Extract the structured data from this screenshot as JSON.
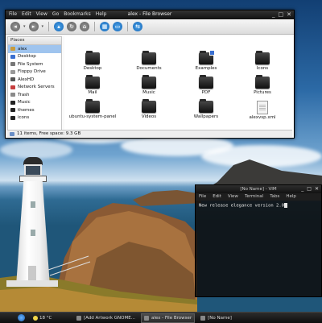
{
  "file_browser": {
    "title": "alex - File Browser",
    "menu": [
      "File",
      "Edit",
      "View",
      "Go",
      "Bookmarks",
      "Help"
    ],
    "window_buttons": [
      "_",
      "□",
      "✕"
    ],
    "toolbar": [
      {
        "icon": "back-arrow-icon",
        "glyph": "◂"
      },
      {
        "icon": "forward-arrow-icon",
        "glyph": "▸"
      },
      {
        "icon": "up-arrow-icon",
        "glyph": "▴"
      },
      {
        "icon": "reload-icon",
        "glyph": "↻"
      },
      {
        "icon": "home-icon",
        "glyph": "⌂"
      },
      {
        "icon": "folder-view-icon",
        "glyph": "▦"
      },
      {
        "icon": "computer-icon",
        "glyph": "▭"
      },
      {
        "icon": "network-icon",
        "glyph": "⇆"
      }
    ],
    "sidebar": {
      "header": "Places",
      "items": [
        {
          "label": "alex",
          "color": "#c89b3c",
          "active": true
        },
        {
          "label": "Desktop",
          "color": "#3a6fd0",
          "active": false
        },
        {
          "label": "File System",
          "color": "#777777",
          "active": false
        },
        {
          "label": "Floppy Drive",
          "color": "#999999",
          "active": false
        },
        {
          "label": "AlexHD",
          "color": "#555555",
          "active": false
        },
        {
          "label": "Network Servers",
          "color": "#c63d3d",
          "active": false
        },
        {
          "label": "Trash",
          "color": "#8a8a8a",
          "active": false
        },
        {
          "label": "Music",
          "color": "#222222",
          "active": false
        },
        {
          "label": "themes",
          "color": "#222222",
          "active": false
        },
        {
          "label": "icons",
          "color": "#222222",
          "active": false
        }
      ]
    },
    "items": [
      {
        "label": "Desktop",
        "type": "folder",
        "icon": "desktop-folder-icon"
      },
      {
        "label": "Documents",
        "type": "folder",
        "icon": "documents-folder-icon"
      },
      {
        "label": "Examples",
        "type": "folder-link",
        "icon": "examples-folder-icon"
      },
      {
        "label": "Icons",
        "type": "folder",
        "icon": "icons-folder-icon"
      },
      {
        "label": "Mail",
        "type": "folder",
        "icon": "mail-folder-icon"
      },
      {
        "label": "Music",
        "type": "folder",
        "icon": "music-folder-icon"
      },
      {
        "label": "PDF",
        "type": "folder",
        "icon": "pdf-folder-icon"
      },
      {
        "label": "Pictures",
        "type": "folder",
        "icon": "pictures-folder-icon"
      },
      {
        "label": "ubuntu-system-panel",
        "type": "folder",
        "icon": "ubuntu-system-panel-folder-icon"
      },
      {
        "label": "Videos",
        "type": "folder",
        "icon": "videos-folder-icon"
      },
      {
        "label": "Wallpapers",
        "type": "folder",
        "icon": "wallpapers-folder-icon"
      },
      {
        "label": "alexvsp.xml",
        "type": "file",
        "icon": "xml-file-icon"
      }
    ],
    "status": "11 items, Free space: 9.3 GB"
  },
  "terminal": {
    "title": "[No Name] - VIM",
    "menu": [
      "File",
      "Edit",
      "View",
      "Terminal",
      "Tabs",
      "Help"
    ],
    "window_buttons": [
      "_",
      "□",
      "✕"
    ],
    "line": "New release elegance version 2.0"
  },
  "taskbar": {
    "weather": "18 °C",
    "tasks": [
      {
        "label": "[Add Artwork GNOME...",
        "active": false
      },
      {
        "label": "alex - File Browser",
        "active": true
      },
      {
        "label": "[No Name]",
        "active": false
      }
    ]
  }
}
